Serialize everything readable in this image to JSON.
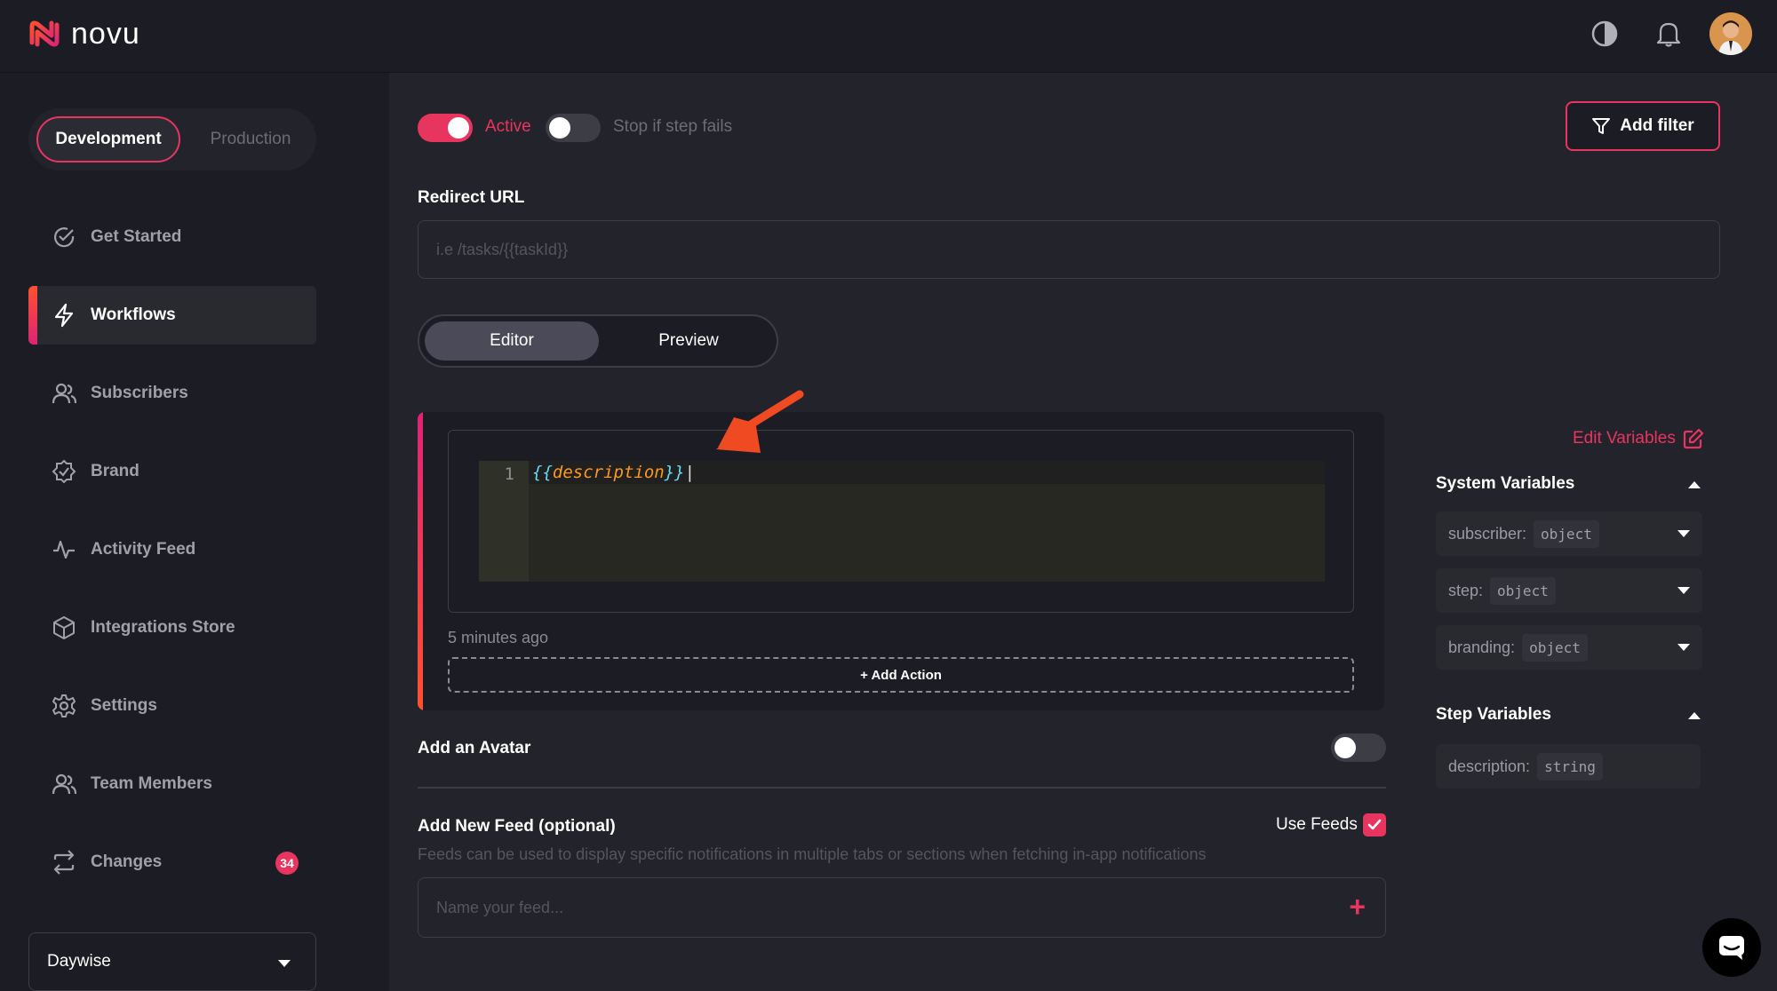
{
  "header": {
    "brand": "novu",
    "icons": [
      "theme-toggle-icon",
      "bell-icon"
    ],
    "avatar": "user-avatar"
  },
  "sidebar": {
    "env": {
      "development": "Development",
      "production": "Production"
    },
    "items": [
      {
        "label": "Get Started",
        "icon": "check-circle-icon"
      },
      {
        "label": "Workflows",
        "icon": "bolt-icon",
        "active": true
      },
      {
        "label": "Subscribers",
        "icon": "users-icon"
      },
      {
        "label": "Brand",
        "icon": "verified-badge-icon"
      },
      {
        "label": "Activity Feed",
        "icon": "activity-icon"
      },
      {
        "label": "Integrations Store",
        "icon": "box-icon"
      },
      {
        "label": "Settings",
        "icon": "gear-icon"
      },
      {
        "label": "Team Members",
        "icon": "team-icon"
      },
      {
        "label": "Changes",
        "icon": "sync-icon",
        "badge": "34"
      }
    ],
    "organization": "Daywise"
  },
  "main": {
    "active_label": "Active",
    "stop_label": "Stop if step fails",
    "add_filter": "Add filter",
    "redirect": {
      "label": "Redirect URL",
      "placeholder": "i.e /tasks/{{taskId}}"
    },
    "tabs": {
      "editor": "Editor",
      "preview": "Preview"
    },
    "code": {
      "line_number": "1",
      "open": "{{",
      "var": "description",
      "close": "}}"
    },
    "timestamp": "5 minutes ago",
    "add_action": "+ Add Action",
    "avatar_label": "Add an Avatar",
    "feed": {
      "title": "Add New Feed (optional)",
      "use_feeds": "Use Feeds",
      "description": "Feeds can be used to display specific notifications in multiple tabs or sections when fetching in-app notifications",
      "placeholder": "Name your feed..."
    }
  },
  "variables": {
    "edit": "Edit Variables",
    "system_title": "System Variables",
    "system": [
      {
        "name": "subscriber:",
        "type": "object"
      },
      {
        "name": "step:",
        "type": "object"
      },
      {
        "name": "branding:",
        "type": "object"
      }
    ],
    "step_title": "Step Variables",
    "step": [
      {
        "name": "description:",
        "type": "string"
      }
    ]
  },
  "colors": {
    "accent": "#e83560",
    "bg": "#1c1c24",
    "panel": "#23232b"
  }
}
